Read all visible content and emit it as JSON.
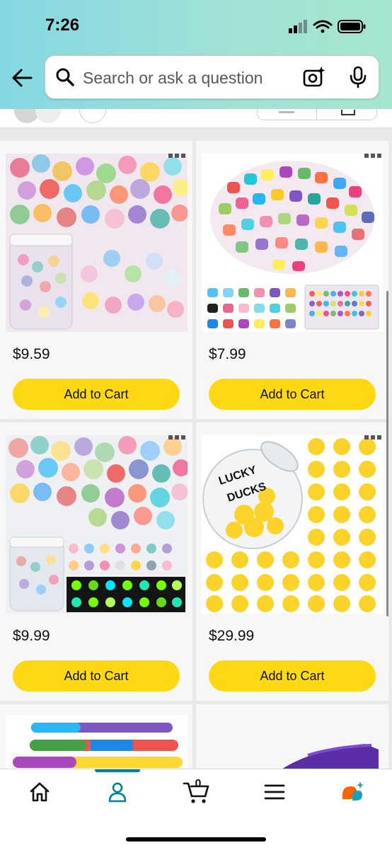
{
  "status_bar": {
    "time": "7:26"
  },
  "header": {
    "search_placeholder": "Search or ask a question"
  },
  "products": [
    {
      "price": "$9.59",
      "button": "Add to Cart",
      "image": "glitter-resin-ducks-jar"
    },
    {
      "price": "$7.99",
      "button": "Add to Cart",
      "image": "colorful-mini-ducks-pile"
    },
    {
      "price": "$9.99",
      "button": "Add to Cart",
      "image": "glow-resin-ducks-jar"
    },
    {
      "price": "$29.99",
      "button": "Add to Cart",
      "image": "lucky-ducks-jar-rubber-ducks"
    },
    {
      "image": "birthday-silicone-wristbands"
    },
    {
      "image": "purple-item"
    }
  ],
  "tabbar": {
    "items": [
      "home-icon",
      "account-icon",
      "cart-icon",
      "menu-icon",
      "rufus-icon"
    ],
    "cart_count": "0",
    "active": "account"
  },
  "colors": {
    "accent": "#008296",
    "button": "#ffd814",
    "header": "#9fe1d6"
  }
}
